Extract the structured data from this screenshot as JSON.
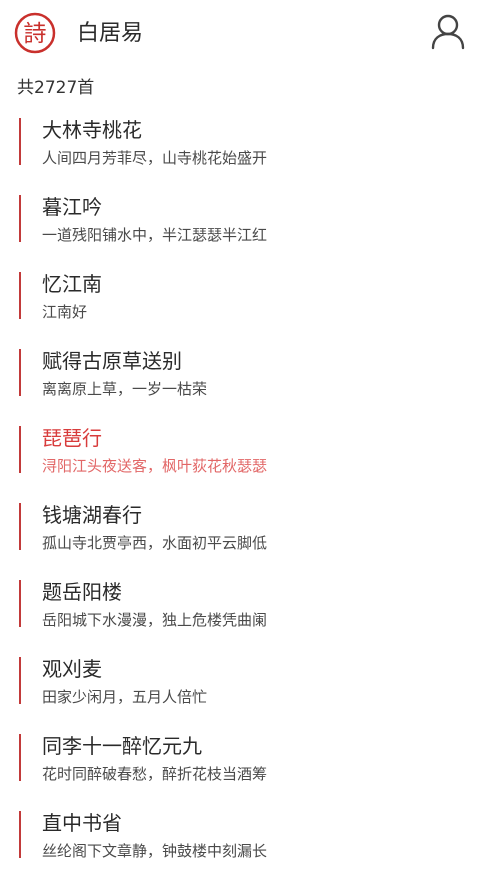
{
  "header": {
    "title": "白居易",
    "logo_text": "詩",
    "logo_icon": "seal-logo-icon",
    "user_icon": "user-icon"
  },
  "count_label": "共2727首",
  "colors": {
    "accent": "#c23a3a",
    "active_title": "#d83c3c",
    "active_line": "#e26767"
  },
  "poems": [
    {
      "title": "大林寺桃花",
      "line": "人间四月芳菲尽，山寺桃花始盛开"
    },
    {
      "title": "暮江吟",
      "line": "一道残阳铺水中，半江瑟瑟半江红"
    },
    {
      "title": "忆江南",
      "line": "江南好"
    },
    {
      "title": "赋得古原草送别",
      "line": "离离原上草，一岁一枯荣"
    },
    {
      "title": "琵琶行",
      "line": "浔阳江头夜送客，枫叶荻花秋瑟瑟",
      "active": true
    },
    {
      "title": "钱塘湖春行",
      "line": "孤山寺北贾亭西，水面初平云脚低"
    },
    {
      "title": "题岳阳楼",
      "line": "岳阳城下水漫漫，独上危楼凭曲阑"
    },
    {
      "title": "观刈麦",
      "line": "田家少闲月，五月人倍忙"
    },
    {
      "title": "同李十一醉忆元九",
      "line": "花时同醉破春愁，醉折花枝当酒筹"
    },
    {
      "title": "直中书省",
      "line": "丝纶阁下文章静，钟鼓楼中刻漏长"
    }
  ]
}
